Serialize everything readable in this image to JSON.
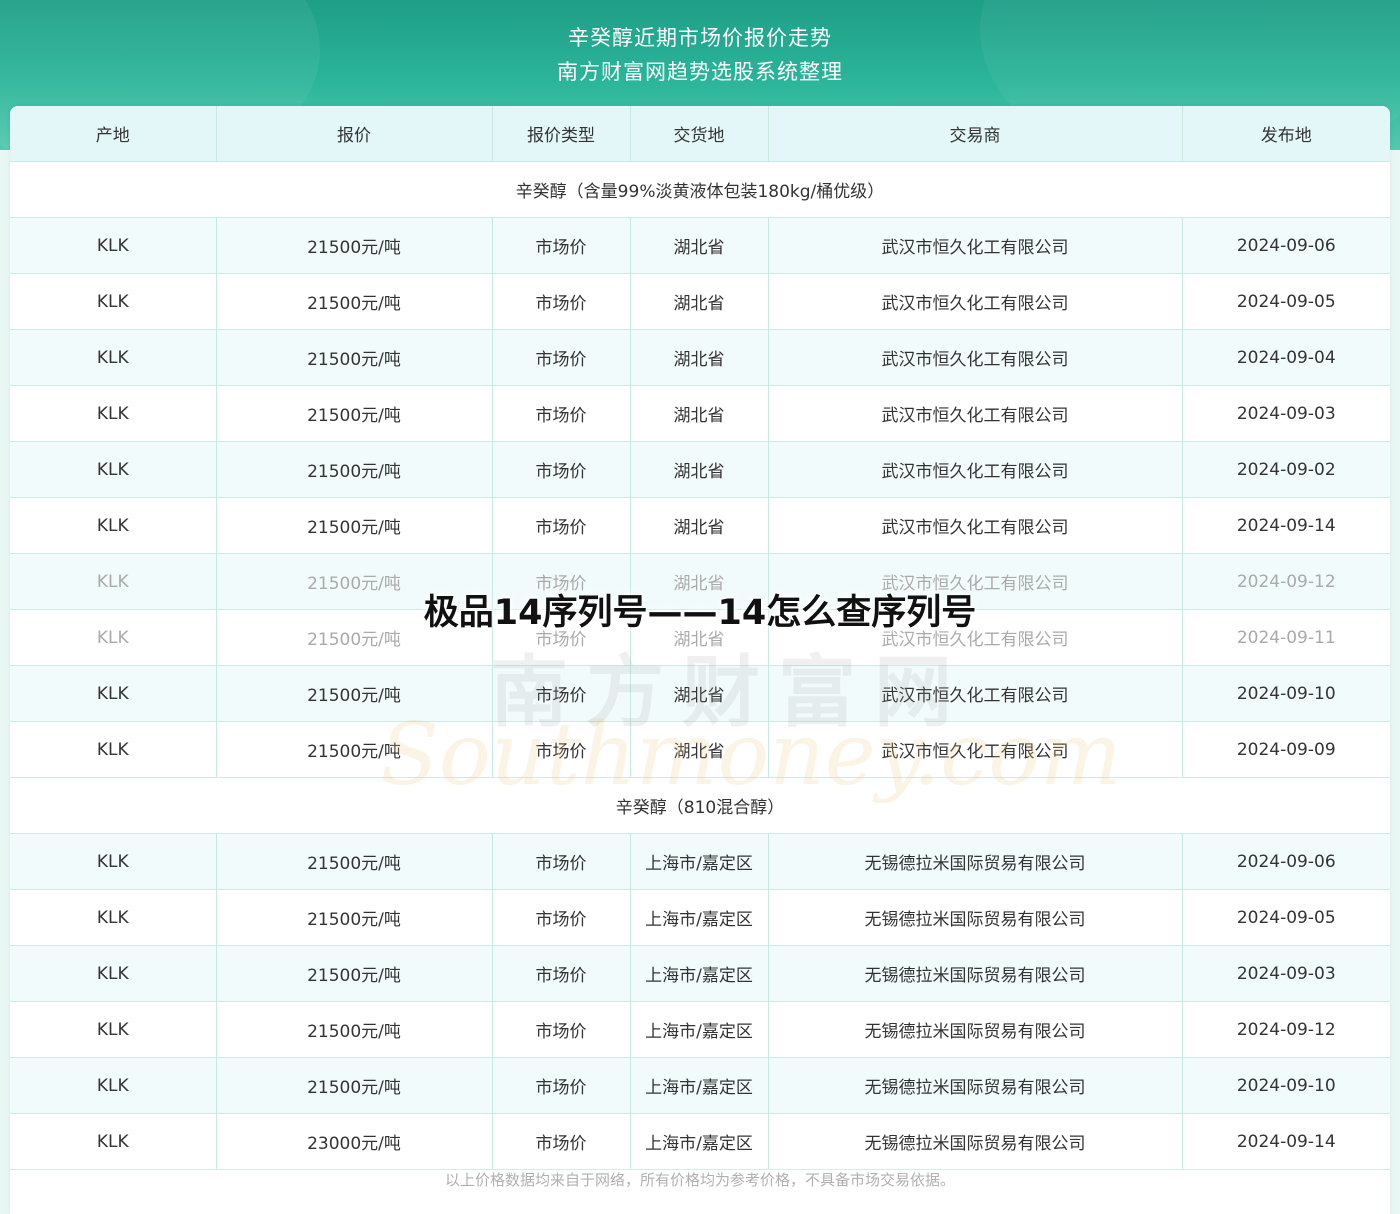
{
  "banner": {
    "title_line1": "辛癸醇近期市场价报价走势",
    "title_line2": "南方财富网趋势选股系统整理"
  },
  "table": {
    "headers": [
      "产地",
      "报价",
      "报价类型",
      "交货地",
      "交易商",
      "发布地"
    ],
    "groups": [
      {
        "title": "辛癸醇（含量99%淡黄液体包装180kg/桶优级）",
        "rows": [
          [
            "KLK",
            "21500元/吨",
            "市场价",
            "湖北省",
            "武汉市恒久化工有限公司",
            "2024-09-06"
          ],
          [
            "KLK",
            "21500元/吨",
            "市场价",
            "湖北省",
            "武汉市恒久化工有限公司",
            "2024-09-05"
          ],
          [
            "KLK",
            "21500元/吨",
            "市场价",
            "湖北省",
            "武汉市恒久化工有限公司",
            "2024-09-04"
          ],
          [
            "KLK",
            "21500元/吨",
            "市场价",
            "湖北省",
            "武汉市恒久化工有限公司",
            "2024-09-03"
          ],
          [
            "KLK",
            "21500元/吨",
            "市场价",
            "湖北省",
            "武汉市恒久化工有限公司",
            "2024-09-02"
          ],
          [
            "KLK",
            "21500元/吨",
            "市场价",
            "湖北省",
            "武汉市恒久化工有限公司",
            "2024-09-14"
          ],
          [
            "KLK",
            "21500元/吨",
            "市场价",
            "湖北省",
            "武汉市恒久化工有限公司",
            "2024-09-12"
          ],
          [
            "KLK",
            "21500元/吨",
            "市场价",
            "湖北省",
            "武汉市恒久化工有限公司",
            "2024-09-11"
          ],
          [
            "KLK",
            "21500元/吨",
            "市场价",
            "湖北省",
            "武汉市恒久化工有限公司",
            "2024-09-10"
          ],
          [
            "KLK",
            "21500元/吨",
            "市场价",
            "湖北省",
            "武汉市恒久化工有限公司",
            "2024-09-09"
          ]
        ]
      },
      {
        "title": "辛癸醇（810混合醇）",
        "rows": [
          [
            "KLK",
            "21500元/吨",
            "市场价",
            "上海市/嘉定区",
            "无锡德拉米国际贸易有限公司",
            "2024-09-06"
          ],
          [
            "KLK",
            "21500元/吨",
            "市场价",
            "上海市/嘉定区",
            "无锡德拉米国际贸易有限公司",
            "2024-09-05"
          ],
          [
            "KLK",
            "21500元/吨",
            "市场价",
            "上海市/嘉定区",
            "无锡德拉米国际贸易有限公司",
            "2024-09-03"
          ],
          [
            "KLK",
            "21500元/吨",
            "市场价",
            "上海市/嘉定区",
            "无锡德拉米国际贸易有限公司",
            "2024-09-12"
          ],
          [
            "KLK",
            "21500元/吨",
            "市场价",
            "上海市/嘉定区",
            "无锡德拉米国际贸易有限公司",
            "2024-09-10"
          ],
          [
            "KLK",
            "23000元/吨",
            "市场价",
            "上海市/嘉定区",
            "无锡德拉米国际贸易有限公司",
            "2024-09-14"
          ]
        ]
      }
    ],
    "footer_note": "以上价格数据均来自于网络，所有价格均为参考价格，不具备市场交易依据。"
  },
  "watermark": {
    "cn": "南方财富网",
    "en": "Southmoney.com"
  },
  "overlay_title": "极品14序列号——14怎么查序列号"
}
